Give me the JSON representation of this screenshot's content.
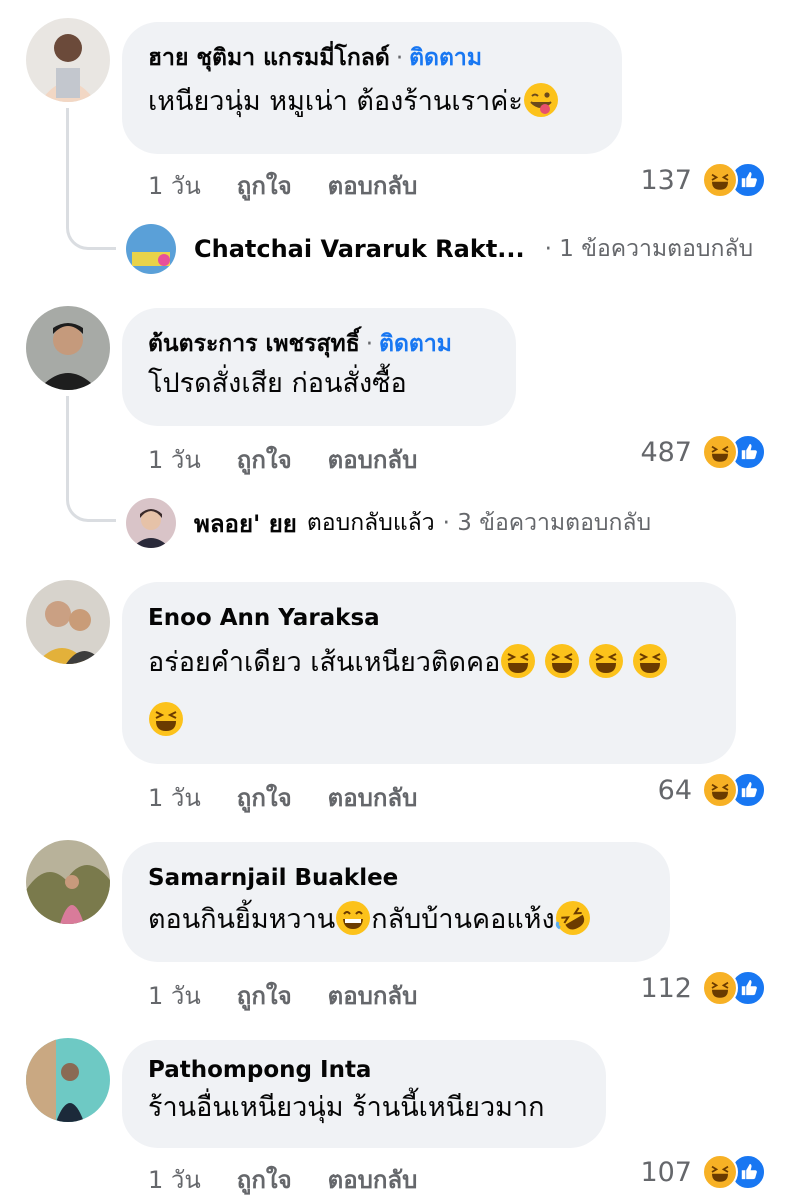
{
  "comments": [
    {
      "author": "ฮาย ชุติมา แกรมมี่โกลด์",
      "follow": "ติดตาม",
      "text": "เหนียวนุ่ม หมูเน่า ต้องร้านเราค่ะ",
      "time": "1 วัน",
      "like": "ถูกใจ",
      "reply": "ตอบกลับ",
      "reactions": "137",
      "reply_preview": {
        "name": "Chatchai Vararuk Rakt...",
        "extra": "· 1 ข้อความตอบกลับ"
      }
    },
    {
      "author": "ต้นตระการ เพชรสุทธิ์",
      "follow": "ติดตาม",
      "text": "โปรดสั่งเสีย ก่อนสั่งซื้อ",
      "time": "1 วัน",
      "like": "ถูกใจ",
      "reply": "ตอบกลับ",
      "reactions": "487",
      "reply_preview": {
        "name": "พลอย' ยย",
        "action": "ตอบกลับแล้ว",
        "extra": "· 3 ข้อความตอบกลับ"
      }
    },
    {
      "author": "Enoo Ann Yaraksa",
      "text": "อร่อยคำเดียว เส้นเหนียวติดคอ",
      "time": "1 วัน",
      "like": "ถูกใจ",
      "reply": "ตอบกลับ",
      "reactions": "64"
    },
    {
      "author": "Samarnjail Buaklee",
      "text_a": "ตอนกินยิ้มหวาน",
      "text_b": "กลับบ้านคอแห้ง",
      "time": "1 วัน",
      "like": "ถูกใจ",
      "reply": "ตอบกลับ",
      "reactions": "112"
    },
    {
      "author": "Pathompong Inta",
      "text": "ร้านอื่นเหนียวนุ่ม ร้านนี้เหนียวมาก",
      "time": "1 วัน",
      "like": "ถูกใจ",
      "reply": "ตอบกลับ",
      "reactions": "107"
    }
  ],
  "colors": {
    "accent": "#1877f2",
    "bubble": "#f0f2f5",
    "muted": "#65676b",
    "haha": "#f7b125"
  },
  "icons": [
    "haha-reaction-icon",
    "like-reaction-icon",
    "winking-tongue-emoji",
    "laughing-emoji",
    "grinning-emoji",
    "rofl-emoji"
  ]
}
